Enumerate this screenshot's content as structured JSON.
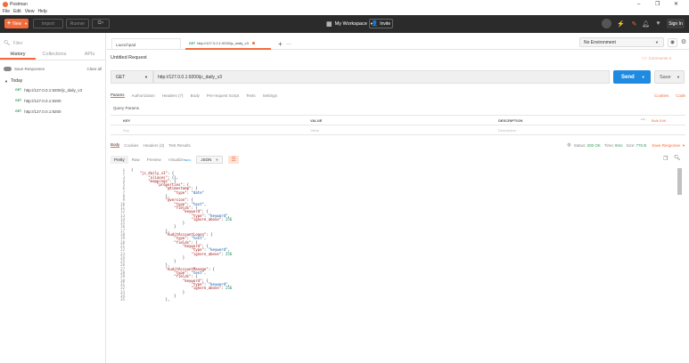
{
  "window": {
    "title": "Postman",
    "minimize": "–",
    "restore": "❐",
    "close": "✕"
  },
  "menu": [
    "File",
    "Edit",
    "View",
    "Help"
  ],
  "header": {
    "new_label": "New",
    "import_label": "Import",
    "runner_label": "Runner",
    "workspace_label": "My Workspace",
    "invite_label": "Invite",
    "signin_label": "Sign In"
  },
  "sidebar": {
    "filter_placeholder": "Filter",
    "tabs": [
      "History",
      "Collections",
      "APIs"
    ],
    "save_responses": "Save Responses",
    "clear_all": "Clear all",
    "group": "Today",
    "items": [
      {
        "method": "GET",
        "url": "http://127.0.0.1:9200/jc_daily_v3"
      },
      {
        "method": "GET",
        "url": "http://127.0.0.1:9200"
      },
      {
        "method": "GET",
        "url": "http://127.0.0.1:9200"
      }
    ]
  },
  "tabs": {
    "launchpad": "Launchpad",
    "active_method": "GET",
    "active_url": "http://127.0.0.1:9200/jc_daily_v3",
    "add": "+",
    "more": "···"
  },
  "environment": {
    "selected": "No Environment"
  },
  "request": {
    "title": "Untitled Request",
    "comments": "Comments 0",
    "method": "GET",
    "url": "http://127.0.0.1:9200/jc_daily_v3",
    "send_label": "Send",
    "save_label": "Save",
    "subtabs": [
      "Params",
      "Authorization",
      "Headers (7)",
      "Body",
      "Pre-request Script",
      "Tests",
      "Settings"
    ],
    "cookies": "Cookies",
    "code": "Code",
    "query_params_title": "Query Params",
    "columns": [
      "KEY",
      "VALUE",
      "DESCRIPTION"
    ],
    "key_placeholder": "Key",
    "value_placeholder": "Value",
    "description_placeholder": "Description",
    "bulk_edit": "Bulk Edit"
  },
  "response": {
    "tabs": [
      "Body",
      "Cookies",
      "Headers (3)",
      "Test Results"
    ],
    "status_label": "Status:",
    "status_value": "200 OK",
    "time_label": "Time:",
    "time_value": "8ms",
    "size_label": "Size:",
    "size_value": "776 B",
    "save_response": "Save Response",
    "formats": [
      "Pretty",
      "Raw",
      "Preview",
      "Visualize"
    ],
    "beta": "BETA",
    "format_select": "JSON"
  },
  "code_lines": [
    "{",
    "    \"jc_daily_v3\": {",
    "        \"aliases\": {},",
    "        \"mappings\": {",
    "            \"properties\": {",
    "                \"@timestamp\": {",
    "                    \"type\": \"date\"",
    "                },",
    "                \"@version\": {",
    "                    \"type\": \"text\",",
    "                    \"fields\": {",
    "                        \"keyword\": {",
    "                            \"type\": \"keyword\",",
    "                            \"ignore_above\": 256",
    "                        }",
    "                    }",
    "                },",
    "                \"AuditAccountLogon\": {",
    "                    \"type\": \"text\",",
    "                    \"fields\": {",
    "                        \"keyword\": {",
    "                            \"type\": \"keyword\",",
    "                            \"ignore_above\": 256",
    "                        }",
    "                    }",
    "                },",
    "                \"AuditAccountManage\": {",
    "                    \"type\": \"text\",",
    "                    \"fields\": {",
    "                        \"keyword\": {",
    "                            \"type\": \"keyword\",",
    "                            \"ignore_above\": 256",
    "                        }",
    "                    }",
    "                },"
  ],
  "colors": {
    "accent": "#f26b3a",
    "send": "#1f8ae0",
    "get": "#2e9c5a",
    "header_bg": "#2b2b2b"
  }
}
